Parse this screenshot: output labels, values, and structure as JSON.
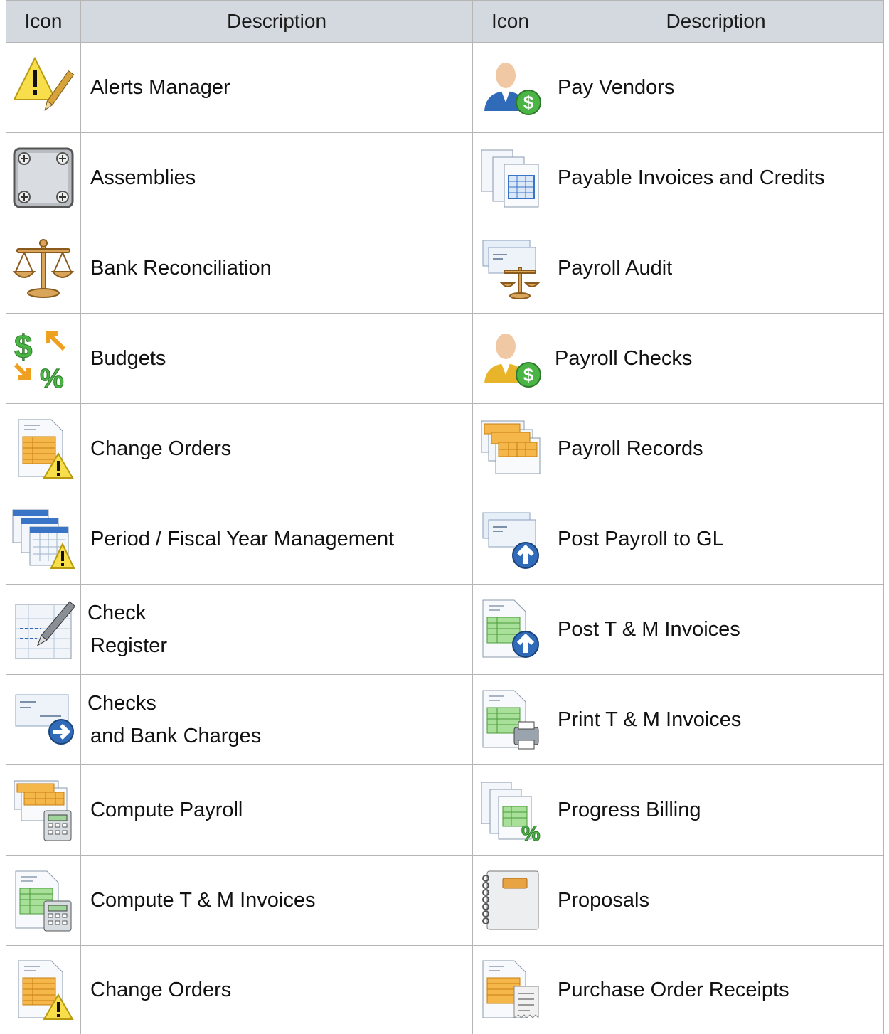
{
  "headers": {
    "icon_col_1": "Icon",
    "desc_col_1": "Description",
    "icon_col_2": "Icon",
    "desc_col_2": "Description"
  },
  "rows": [
    {
      "left": {
        "icon": "alert-pencil-icon",
        "label": "Alerts Manager"
      },
      "right": {
        "icon": "person-dollar-blue-icon",
        "label": "Pay Vendors"
      }
    },
    {
      "left": {
        "icon": "metal-plate-screws-icon",
        "label": "Assemblies"
      },
      "right": {
        "icon": "stacked-documents-table-icon",
        "label": "Payable Invoices and Credits"
      }
    },
    {
      "left": {
        "icon": "balance-scale-icon",
        "label": "Bank Reconciliation"
      },
      "right": {
        "icon": "checks-scale-icon",
        "label": "Payroll Audit"
      }
    },
    {
      "left": {
        "icon": "dollar-percent-arrows-icon",
        "label": "Budgets"
      },
      "right": {
        "icon": "person-dollar-gold-icon",
        "label": "Payroll Checks"
      }
    },
    {
      "left": {
        "icon": "document-warning-icon",
        "label": "Change Orders"
      },
      "right": {
        "icon": "stacked-ledgers-icon",
        "label": "Payroll Records"
      }
    },
    {
      "left": {
        "icon": "calendars-warning-icon",
        "label": "Period / Fiscal Year Management"
      },
      "right": {
        "icon": "checks-upload-icon",
        "label": "Post Payroll to GL"
      }
    },
    {
      "left": {
        "icon": "register-pen-icon",
        "label_line1": "Check",
        "label_line2": "Register"
      },
      "right": {
        "icon": "green-document-upload-icon",
        "label": "Post T & M Invoices"
      }
    },
    {
      "left": {
        "icon": "check-arrow-icon",
        "label_line1": "Checks",
        "label_line2": "and Bank Charges"
      },
      "right": {
        "icon": "green-document-printer-icon",
        "label": "Print T & M Invoices"
      }
    },
    {
      "left": {
        "icon": "ledgers-calculator-icon",
        "label": "Compute Payroll"
      },
      "right": {
        "icon": "stacked-documents-percent-icon",
        "label": "Progress Billing"
      }
    },
    {
      "left": {
        "icon": "green-document-calculator-icon",
        "label": "Compute T & M Invoices"
      },
      "right": {
        "icon": "notebook-icon",
        "label": "Proposals"
      }
    },
    {
      "left": {
        "icon": "document-warning-icon",
        "label": "Change Orders"
      },
      "right": {
        "icon": "document-receipt-icon",
        "label": "Purchase Order Receipts"
      }
    }
  ]
}
